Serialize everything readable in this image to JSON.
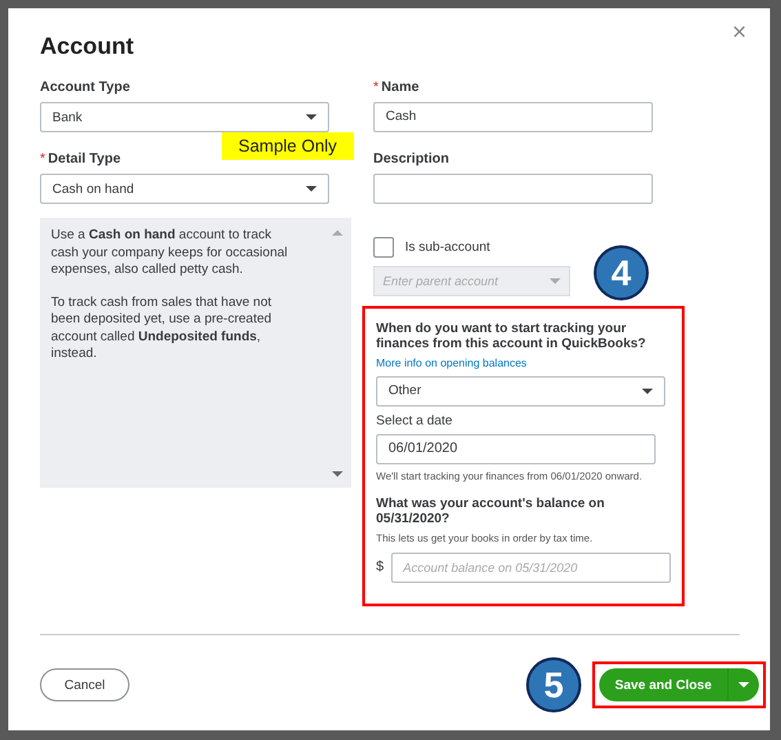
{
  "dialog": {
    "title": "Account",
    "close": "×"
  },
  "account_type": {
    "label": "Account Type",
    "value": "Bank"
  },
  "detail_type": {
    "label": "Detail Type",
    "required_mark": "*",
    "value": "Cash on hand"
  },
  "sample_note": "Sample Only",
  "help_text": [
    "Use a **Cash on hand** account to track cash your company keeps for occasional expenses, also called petty cash.",
    "To track cash from sales that have not been deposited yet, use a pre-created account called **Undeposited funds**, instead."
  ],
  "name": {
    "label": "Name",
    "required_mark": "*",
    "value": "Cash"
  },
  "description": {
    "label": "Description"
  },
  "sub_account": {
    "label": "Is sub-account",
    "checked": false,
    "parent_placeholder": "Enter parent account"
  },
  "step_badges": [
    "4",
    "5"
  ],
  "opening": {
    "question": "When do you want to start tracking your finances from this account in QuickBooks?",
    "link": "More info on opening balances",
    "option": "Other",
    "date_label": "Select a date",
    "date": "06/01/2020",
    "date_note": "We'll start tracking your finances from 06/01/2020 onward.",
    "balance_question": "What was your account's balance on 05/31/2020?",
    "balance_note": "This lets us get your books in order by tax time.",
    "currency": "$",
    "balance_placeholder": "Account balance on 05/31/2020"
  },
  "buttons": {
    "cancel": "Cancel",
    "save": "Save and Close"
  }
}
